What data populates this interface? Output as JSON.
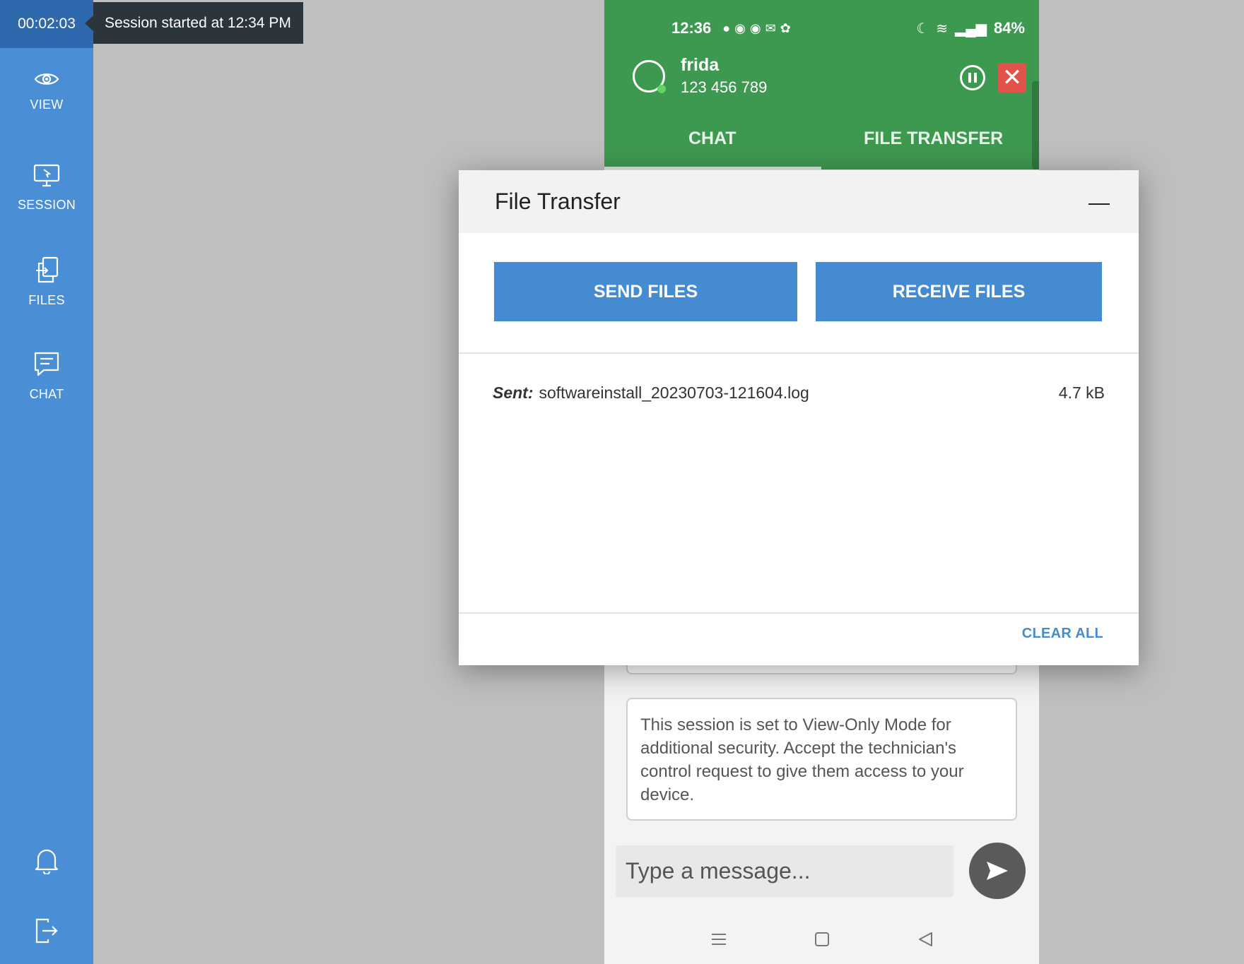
{
  "sidebar": {
    "timer": "00:02:03",
    "tooltip": "Session started at 12:34 PM",
    "items": [
      {
        "label": "VIEW",
        "icon": "eye-icon"
      },
      {
        "label": "SESSION",
        "icon": "monitor-icon"
      },
      {
        "label": "FILES",
        "icon": "files-icon"
      },
      {
        "label": "CHAT",
        "icon": "chat-icon"
      }
    ],
    "bottom_icons": [
      "bell-icon",
      "logout-icon"
    ],
    "colors": {
      "background": "#4a8fd6",
      "timer_bg": "#2f69ad"
    }
  },
  "phone": {
    "status_time": "12:36",
    "battery": "84%",
    "agent_name": "frida",
    "agent_phone": "123 456 789",
    "tabs": [
      "CHAT",
      "FILE TRANSFER"
    ],
    "active_tab": "CHAT",
    "notice": "This session is set to View-Only Mode for additional security. Accept the technician's control request to give them access to your device.",
    "message_placeholder": "Type a message...",
    "colors": {
      "header": "#3e9950",
      "close": "#e2534b"
    }
  },
  "modal": {
    "title": "File Transfer",
    "send_label": "SEND FILES",
    "receive_label": "RECEIVE FILES",
    "files": [
      {
        "status": "Sent:",
        "name": "softwareinstall_20230703-121604.log",
        "size": "4.7 kB"
      }
    ],
    "clear_all": "CLEAR ALL",
    "colors": {
      "button": "#458bd2"
    }
  }
}
